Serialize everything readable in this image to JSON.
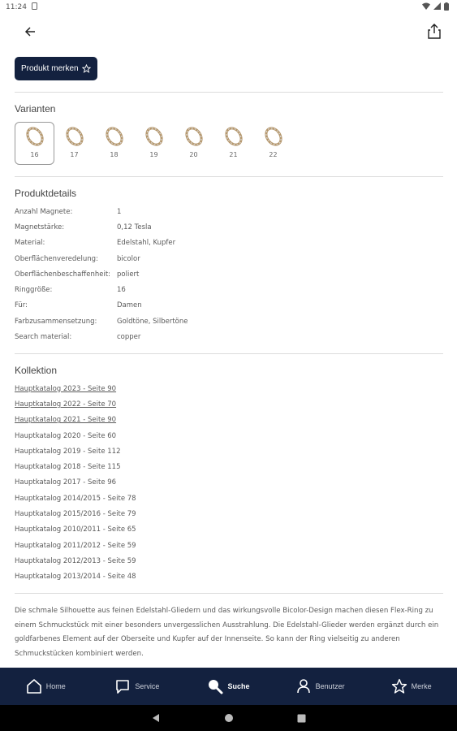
{
  "status": {
    "time": "11:24"
  },
  "product": {
    "merken_label": "Produkt merken"
  },
  "variants": {
    "title": "Varianten",
    "items": [
      {
        "size": "16",
        "selected": true
      },
      {
        "size": "17"
      },
      {
        "size": "18"
      },
      {
        "size": "19"
      },
      {
        "size": "20"
      },
      {
        "size": "21"
      },
      {
        "size": "22"
      }
    ]
  },
  "details": {
    "title": "Produktdetails",
    "rows": [
      {
        "k": "Anzahl Magnete:",
        "v": "1"
      },
      {
        "k": "Magnetstärke:",
        "v": "0,12 Tesla"
      },
      {
        "k": "Material:",
        "v": "Edelstahl, Kupfer"
      },
      {
        "k": "Oberflächenveredelung:",
        "v": "bicolor"
      },
      {
        "k": "Oberflächenbeschaffenheit:",
        "v": "poliert"
      },
      {
        "k": "Ringgröße:",
        "v": "16"
      },
      {
        "k": "Für:",
        "v": "Damen"
      },
      {
        "k": "Farbzusammensetzung:",
        "v": "Goldtöne, Silbertöne"
      },
      {
        "k": "Search material:",
        "v": "copper"
      }
    ]
  },
  "collection": {
    "title": "Kollektion",
    "items": [
      {
        "label": "Hauptkatalog 2023 - Seite 90",
        "link": true
      },
      {
        "label": "Hauptkatalog 2022 - Seite 70",
        "link": true
      },
      {
        "label": "Hauptkatalog 2021 - Seite 90",
        "link": true
      },
      {
        "label": "Hauptkatalog 2020 - Seite 60"
      },
      {
        "label": "Hauptkatalog 2019 - Seite 112"
      },
      {
        "label": "Hauptkatalog 2018 - Seite 115"
      },
      {
        "label": "Hauptkatalog 2017 - Seite 96"
      },
      {
        "label": "Hauptkatalog 2014/2015 - Seite 78"
      },
      {
        "label": "Hauptkatalog 2015/2016 - Seite 79"
      },
      {
        "label": "Hauptkatalog 2010/2011 - Seite 65"
      },
      {
        "label": "Hauptkatalog 2011/2012 - Seite 59"
      },
      {
        "label": "Hauptkatalog 2012/2013 - Seite 59"
      },
      {
        "label": "Hauptkatalog 2013/2014 - Seite 48"
      }
    ]
  },
  "description": "Die schmale Silhouette aus feinen Edelstahl-Gliedern und das wirkungsvolle Bicolor-Design machen diesen Flex-Ring zu einem Schmuckstück mit einer besonders unvergesslichen Ausstrahlung. Die Edelstahl-Glieder werden ergänzt durch ein goldfarbenes Element auf der Oberseite und Kupfer auf der Innenseite. So kann der Ring vielseitig zu anderen Schmuckstücken kombiniert werden.",
  "nav": {
    "items": [
      {
        "label": "Home",
        "icon": "home-icon"
      },
      {
        "label": "Service",
        "icon": "chat-icon"
      },
      {
        "label": "Suche",
        "icon": "search-icon",
        "active": true
      },
      {
        "label": "Benutzer",
        "icon": "user-icon"
      },
      {
        "label": "Merke",
        "icon": "star-icon"
      }
    ]
  },
  "colors": {
    "brand": "#13213f",
    "divider": "#dcdcdc"
  }
}
